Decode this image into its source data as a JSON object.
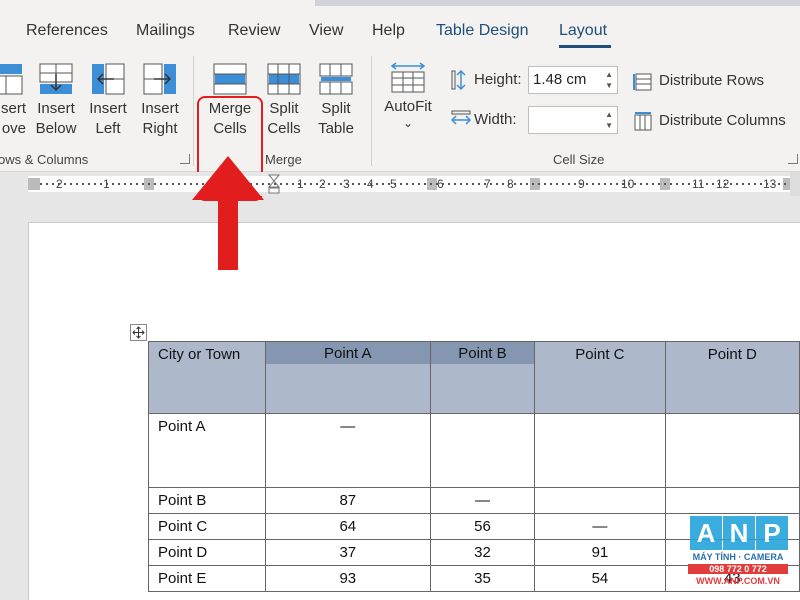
{
  "tabs": [
    "References",
    "Mailings",
    "Review",
    "View",
    "Help",
    "Table Design",
    "Layout"
  ],
  "ribbon": {
    "rows_columns": {
      "insert_above_l1": "sert",
      "insert_above_l2": "ove",
      "insert_below_l1": "Insert",
      "insert_below_l2": "Below",
      "insert_left_l1": "Insert",
      "insert_left_l2": "Left",
      "insert_right_l1": "Insert",
      "insert_right_l2": "Right",
      "group_label": "ows & Columns"
    },
    "merge": {
      "merge_cells_l1": "Merge",
      "merge_cells_l2": "Cells",
      "split_cells_l1": "Split",
      "split_cells_l2": "Cells",
      "split_table_l1": "Split",
      "split_table_l2": "Table",
      "group_label": "Merge"
    },
    "cell_size": {
      "autofit": "AutoFit",
      "autofit_chevron": "⌄",
      "height_label": "Height:",
      "height_value": "1.48 cm",
      "width_label": "Width:",
      "width_value": "",
      "distribute_rows": "Distribute Rows",
      "distribute_columns": "Distribute Columns",
      "group_label": "Cell Size"
    }
  },
  "ruler": {
    "labels": [
      "2",
      "1",
      "1",
      "2",
      "3",
      "4",
      "5",
      "6",
      "7",
      "8",
      "9",
      "10",
      "11",
      "12",
      "13"
    ]
  },
  "table": {
    "header": [
      "City or Town",
      "Point A",
      "Point B",
      "Point C",
      "Point D"
    ],
    "rows": [
      [
        "Point A",
        "—",
        "",
        "",
        ""
      ],
      [
        "Point B",
        "87",
        "—",
        "",
        ""
      ],
      [
        "Point C",
        "64",
        "56",
        "—",
        ""
      ],
      [
        "Point D",
        "37",
        "32",
        "91",
        ""
      ],
      [
        "Point E",
        "93",
        "35",
        "54",
        "43"
      ]
    ]
  },
  "watermark": {
    "letters": [
      "A",
      "N",
      "P"
    ],
    "line1": "MÁY TÍNH · CAMERA",
    "line2": "098 772 0 772",
    "line3": "WWW.ANP.COM.VN"
  },
  "colors": {
    "accent": "#1e4e79",
    "header_fill": "#adb9ca",
    "selected_fill": "#8496b0",
    "highlight": "#e41e1e"
  }
}
